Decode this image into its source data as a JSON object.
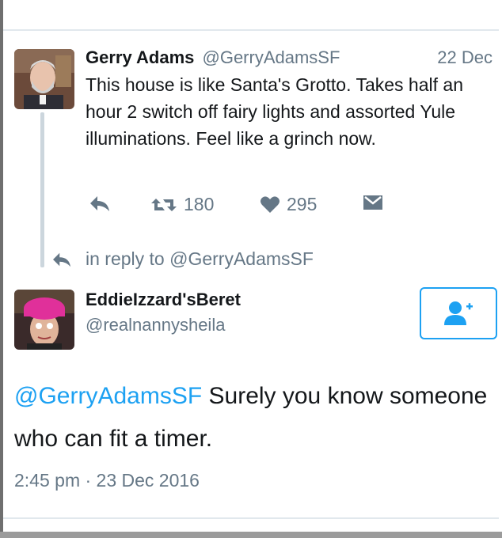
{
  "original_tweet": {
    "display_name": "Gerry Adams",
    "handle": "@GerryAdamsSF",
    "date": "22 Dec",
    "text": "This house is like Santa's Grotto. Takes half an hour 2 switch off fairy lights and assorted Yule illuminations. Feel like a grinch now.",
    "actions": {
      "reply_icon": "reply-arrow-icon",
      "retweet_icon": "retweet-icon",
      "retweet_count": "180",
      "like_icon": "heart-icon",
      "like_count": "295",
      "dm_icon": "envelope-icon"
    }
  },
  "reply_context": {
    "icon": "reply-arrow-icon",
    "label": "in reply to @GerryAdamsSF"
  },
  "reply_tweet": {
    "display_name": "EddieIzzard'sBeret",
    "handle": "@realnannysheila",
    "follow_icon": "follow-user-icon",
    "mention": "@GerryAdamsSF",
    "text_rest": " Surely you know someone who can fit a timer.",
    "timestamp": "2:45 pm · 23 Dec 2016"
  },
  "colors": {
    "accent": "#1da1f2",
    "secondary_text": "#657786",
    "primary_text": "#14171a",
    "divider": "#e1e8ed"
  }
}
